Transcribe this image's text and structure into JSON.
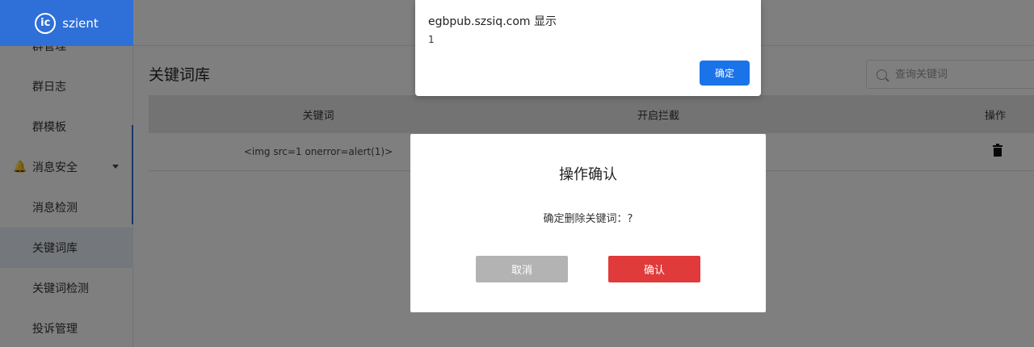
{
  "app": {
    "logo_mark": "ic",
    "logo_text": "szient",
    "brand_color": "#2f6fd8"
  },
  "sidebar": {
    "items": [
      {
        "label": "群管理"
      },
      {
        "label": "群日志"
      },
      {
        "label": "群模板"
      }
    ],
    "group": {
      "label": "消息安全",
      "icon": "bell-icon"
    },
    "sub_items": [
      {
        "label": "消息检测"
      },
      {
        "label": "关键词库",
        "active": true
      },
      {
        "label": "关键词检测"
      },
      {
        "label": "投诉管理"
      }
    ]
  },
  "page": {
    "title": "关键词库"
  },
  "search": {
    "placeholder": "查询关键词",
    "value": ""
  },
  "table": {
    "columns": [
      "关键词",
      "开启拦截",
      "操作"
    ],
    "rows": [
      {
        "keyword": "<img src=1 onerror=alert(1)>",
        "enabled": false,
        "action_icon": "trash-icon"
      }
    ]
  },
  "confirm_dialog": {
    "title": "操作确认",
    "message": "确定删除关键词：?",
    "cancel_label": "取消",
    "confirm_label": "确认",
    "confirm_color": "#e03a3a"
  },
  "browser_alert": {
    "title": "egbpub.szsiq.com 显示",
    "message": "1",
    "ok_label": "确定",
    "ok_color": "#1a73e8"
  }
}
